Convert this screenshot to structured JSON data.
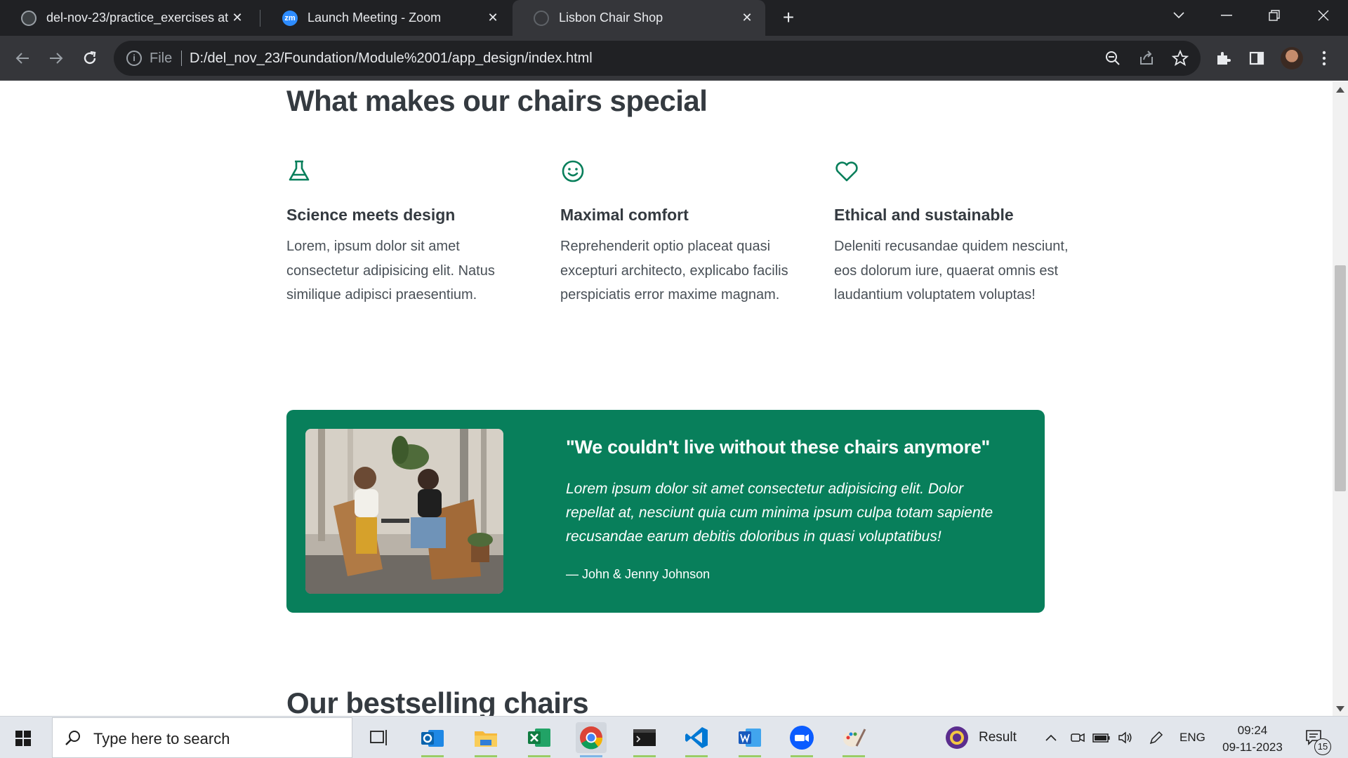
{
  "browser": {
    "tabs": [
      {
        "title": "del-nov-23/practice_exercises at",
        "icon": "github-icon"
      },
      {
        "title": "Launch Meeting - Zoom",
        "icon": "zoom-icon",
        "icon_text": "zm"
      },
      {
        "title": "Lisbon Chair Shop",
        "icon": "globe-icon",
        "active": true
      }
    ],
    "address": {
      "scheme_label": "File",
      "url": "D:/del_nov_23/Foundation/Module%2001/app_design/index.html"
    }
  },
  "page": {
    "section_title": "What makes our chairs special",
    "features": [
      {
        "icon": "flask-icon",
        "title": "Science meets design",
        "text": "Lorem, ipsum dolor sit amet consectetur adipisicing elit. Natus similique adipisci praesentium."
      },
      {
        "icon": "smiley-icon",
        "title": "Maximal comfort",
        "text": "Reprehenderit optio placeat quasi excepturi architecto, explicabo facilis perspiciatis error maxime magnam."
      },
      {
        "icon": "heart-icon",
        "title": "Ethical and sustainable",
        "text": "Deleniti recusandae quidem nesciunt, eos dolorum iure, quaerat omnis est laudantium voluptatem voluptas!"
      }
    ],
    "testimonial": {
      "quote": "\"We couldn't live without these chairs anymore\"",
      "text": "Lorem ipsum dolor sit amet consectetur adipisicing elit. Dolor repellat at, nesciunt quia cum minima ipsum culpa totam sapiente recusandae earum debitis doloribus in quasi voluptatibus!",
      "author": "— John & Jenny Johnson"
    },
    "next_section_title": "Our bestselling chairs"
  },
  "taskbar": {
    "search_placeholder": "Type here to search",
    "result_label": "Result",
    "language": "ENG",
    "time": "09:24",
    "date": "09-11-2023",
    "notification_count": "15"
  },
  "colors": {
    "accent": "#087f5b",
    "heading": "#343a40",
    "body_text": "#495057",
    "chrome_dark": "#202124",
    "chrome_toolbar": "#35363a"
  }
}
